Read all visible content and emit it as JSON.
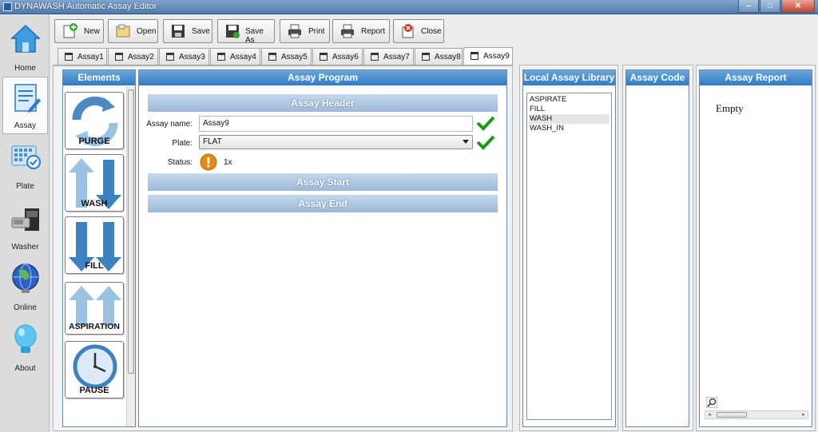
{
  "window": {
    "title": "DYNAWASH Automatic Assay Editor",
    "minimize": "‒",
    "maximize": "□",
    "close": "✕"
  },
  "nav": [
    {
      "id": "home",
      "label": "Home",
      "icon": "home-icon"
    },
    {
      "id": "assay",
      "label": "Assay",
      "icon": "assay-document-icon",
      "active": true
    },
    {
      "id": "plate",
      "label": "Plate",
      "icon": "plate-grid-icon"
    },
    {
      "id": "washer",
      "label": "Washer",
      "icon": "washer-device-icon"
    },
    {
      "id": "online",
      "label": "Online",
      "icon": "globe-icon"
    },
    {
      "id": "about",
      "label": "About",
      "icon": "lightbulb-icon"
    }
  ],
  "toolbar": {
    "new": "New",
    "open": "Open",
    "save": "Save",
    "save_as": "Save As",
    "print": "Print",
    "report": "Report",
    "close": "Close"
  },
  "tabs": [
    "Assay1",
    "Assay2",
    "Assay3",
    "Assay4",
    "Assay5",
    "Assay6",
    "Assay7",
    "Assay8",
    "Assay9"
  ],
  "active_tab": "Assay9",
  "elements": {
    "title": "Elements",
    "items": [
      "PURGE",
      "WASH",
      "FILL",
      "ASPIRATION",
      "PAUSE"
    ]
  },
  "program": {
    "title": "Assay Program",
    "header_title": "Assay Header",
    "name_label": "Assay name:",
    "name_value": "Assay9",
    "plate_label": "Plate:",
    "plate_value": "FLAT",
    "status_label": "Status:",
    "status_value": "1x",
    "start_title": "Assay Start",
    "end_title": "Assay End"
  },
  "library": {
    "title": "Local Assay Library",
    "items": [
      "ASPIRATE",
      "FILL",
      "WASH",
      "WASH_IN"
    ],
    "highlighted": "WASH"
  },
  "code": {
    "title": "Assay Code"
  },
  "report": {
    "title": "Assay Report",
    "content": "Empty"
  },
  "colors": {
    "header_blue": "#2f7bc4",
    "check_green": "#1a9a1a",
    "status_orange": "#e38a10"
  }
}
